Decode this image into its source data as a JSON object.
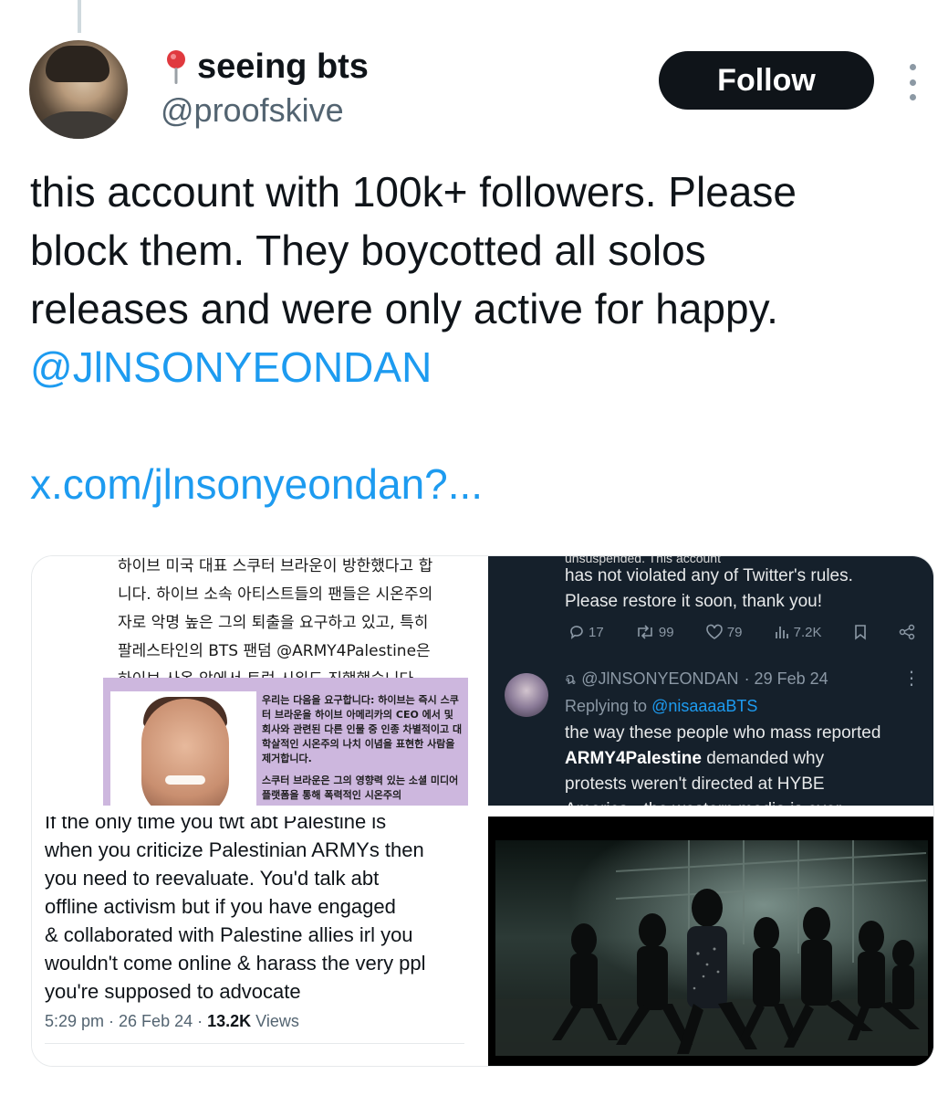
{
  "author": {
    "display_name": "seeing bts",
    "handle": "@proofskive",
    "pin_icon": "round-pushpin-icon"
  },
  "actions": {
    "follow_label": "Follow",
    "more_icon": "more-vertical-icon"
  },
  "tweet": {
    "lines": [
      "this account with 100k+ followers. Please",
      "block them. They boycotted all solos",
      "releases and were only active for happy."
    ],
    "mention": "@JlNSONYEONDAN",
    "link": "x.com/jlnsonyeondan?..."
  },
  "media": {
    "korean_article": {
      "lines": [
        "하이브 미국 대표 스쿠터 브라운이 방한했다고 합",
        "니다. 하이브 소속 아티스트들의 팬들은 시온주의",
        "자로 악명 높은 그의 퇴출을 요구하고 있고, 특히",
        "팔레스타인의 BTS 팬덤 @ARMY4Palestine은",
        "하이브 사옥 앞에서 트럭 시위도 진행했습니다. ..."
      ],
      "demand_paragraphs": [
        "우리는 다음을 요구합니다: 하이브는 즉시 스쿠터 브라운을 하이브 아메리카의 CEO 에서 및 회사와 관련된 다른 인물 중 인종 차별적이고 대학살적인 시온주의 나치 이념을 표현한 사람을 제거합니다.",
        "스쿠터 브라운은 그의 영향력 있는 소셜 미디어 플랫폼을 통해 폭력적인 시온주의"
      ]
    },
    "dark_tweet": {
      "top_cut": "unsuspended. This account",
      "lines": [
        "has not violated any of Twitter's rules.",
        "Please restore it soon, thank you!"
      ],
      "stats": {
        "replies": "17",
        "retweets": "99",
        "likes": "79",
        "views": "7.2K"
      },
      "reply": {
        "prefix": "ฉ",
        "handle": "@JlNSONYEONDAN",
        "date": "· 29 Feb 24",
        "replying_to_label": "Replying to",
        "replying_to_handle": "@nisaaaaBTS",
        "line1": "the way these people who mass reported",
        "bold": "ARMY4Palestine",
        "line2_rest": " demanded why",
        "line3": "protests weren't directed at HYBE",
        "line4": "America - the western media is ever"
      }
    },
    "light_tweet": {
      "lines": [
        "If the only time you twt abt Palestine is",
        "when you criticize Palestinian ARMYs then",
        "you need to reevaluate. You'd talk abt",
        "offline activism but if you have engaged",
        "& collaborated with Palestine allies irl you",
        "wouldn't come online & harass the very ppl",
        "you're supposed to advocate"
      ],
      "time": "5:29 pm · 26 Feb 24 · ",
      "views_count": "13.2K",
      "views_label": " Views"
    },
    "photo": {
      "description_icon": "dance-scene-image"
    }
  },
  "colors": {
    "text": "#0f1419",
    "secondary": "#536471",
    "link": "#1d9bf0",
    "dark_bg": "#15202b",
    "follow_bg": "#0f1419"
  }
}
